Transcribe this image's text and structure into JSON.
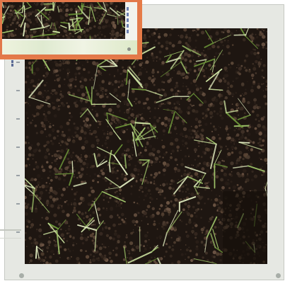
{
  "scene": {
    "description_free": true,
    "colors": {
      "soil_dark": "#1e1611",
      "soil_mid": "#3b2d23",
      "soil_light": "#5a4535",
      "sprout_light": "#cfe5a2",
      "sprout_mid": "#9fc46a",
      "sprout_dark": "#6f9a3a",
      "accent_frame": "#e67b47",
      "print_paper": "#e6e8e3"
    },
    "icons": {
      "main_photo": "soil-seedlings-photo",
      "inset_photo": "seedling-closeup-photo"
    }
  }
}
